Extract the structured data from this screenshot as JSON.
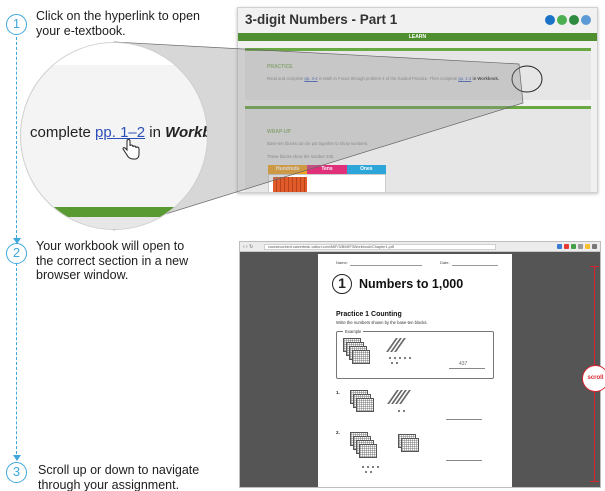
{
  "steps": [
    {
      "number": "1",
      "text_line1": "Click on the hyperlink to open",
      "text_line2": "your e-textbook."
    },
    {
      "number": "2",
      "text_line1": "Your workbook will open to",
      "text_line2": "the correct section in a new",
      "text_line3": "browser window."
    },
    {
      "number": "3",
      "text_line1": "Scroll up or down to navigate",
      "text_line2": "through your assignment."
    }
  ],
  "lesson": {
    "title": "3-digit Numbers - Part 1",
    "learn_bar": "LEARN",
    "practice_heading": "PRACTICE",
    "practice_text_start": "Read and complete",
    "practice_link1": "pp. 3-4",
    "practice_text_mid": "in Math in Focus through problem 4 of the Guided Practice. Then complete",
    "practice_link2": "pp. 1-2",
    "practice_text_end": "in Workbook.",
    "wrapup_heading": "WRAP-UP",
    "wrapup_line1": "Base-ten blocks can be put together to show numbers.",
    "wrapup_line2": "These blocks show the number 235.",
    "table_headers": [
      "Hundreds",
      "Tens",
      "Ones"
    ],
    "icon_colors": [
      "#1a73c7",
      "#4caf50",
      "#2e8a3e",
      "#5c9ad6"
    ]
  },
  "magnifier": {
    "text_before": "complete",
    "link_text": "pp. 1–2",
    "text_in": "in",
    "bold_text": "Workboo"
  },
  "browser": {
    "url": "coursecontent.calvertedu cation.com/MIF/3/B/MIF3Workbook/Chapter1.pdf",
    "name_label": "Name:",
    "date_label": "Date:",
    "chapter_number": "1",
    "chapter_title": "Numbers to 1,000",
    "practice_title": "Practice 1   Counting",
    "practice_instruction": "Write the numbers shown by the base-ten blocks.",
    "example_label": "Example",
    "example_answer": "437",
    "problem_1": "1.",
    "problem_2": "2."
  },
  "scroll_label": "scroll"
}
